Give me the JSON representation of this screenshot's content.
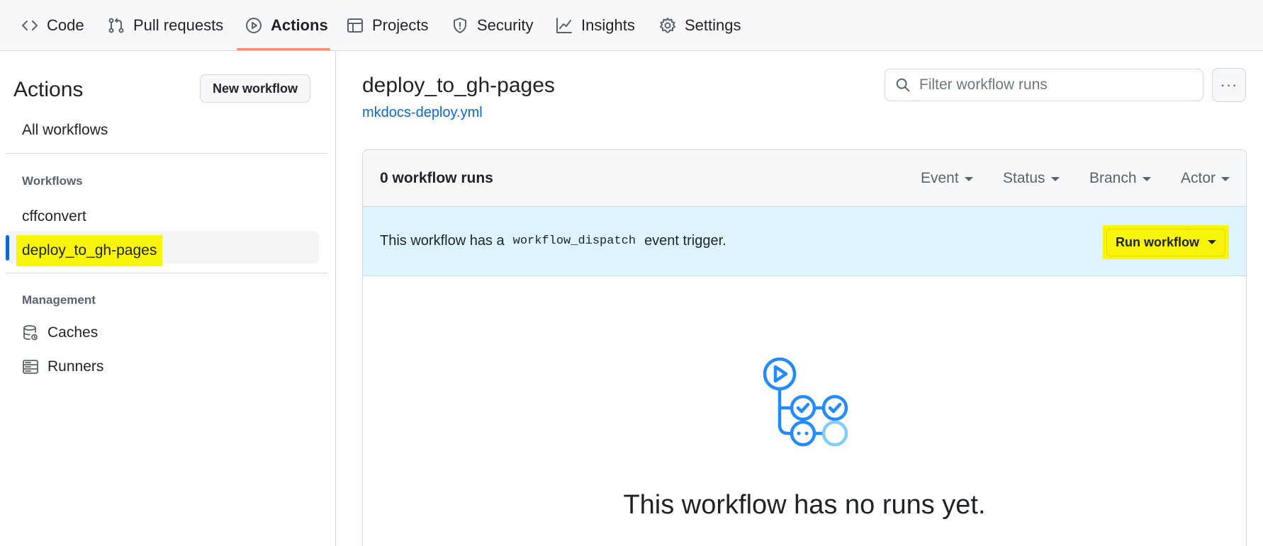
{
  "nav": {
    "tabs": [
      {
        "label": "Code",
        "icon": "code-icon"
      },
      {
        "label": "Pull requests",
        "icon": "pull-request-icon"
      },
      {
        "label": "Actions",
        "icon": "play-icon",
        "active": true
      },
      {
        "label": "Projects",
        "icon": "table-icon"
      },
      {
        "label": "Security",
        "icon": "shield-icon"
      },
      {
        "label": "Insights",
        "icon": "graph-icon"
      },
      {
        "label": "Settings",
        "icon": "gear-icon"
      }
    ]
  },
  "sidebar": {
    "title": "Actions",
    "new_workflow": "New workflow",
    "all_workflows": "All workflows",
    "workflows_heading": "Workflows",
    "workflows": [
      "cffconvert",
      "deploy_to_gh-pages"
    ],
    "management_heading": "Management",
    "management": [
      {
        "label": "Caches",
        "icon": "database-icon"
      },
      {
        "label": "Runners",
        "icon": "server-icon"
      }
    ]
  },
  "main": {
    "title": "deploy_to_gh-pages",
    "file_link": "mkdocs-deploy.yml",
    "search_placeholder": "Filter workflow runs",
    "kebab": "···",
    "runs_count": "0 workflow runs",
    "filters": [
      "Event",
      "Status",
      "Branch",
      "Actor"
    ],
    "banner_prefix": "This workflow has a",
    "banner_code": "workflow_dispatch",
    "banner_suffix": "event trigger.",
    "run_button": "Run workflow",
    "empty_message": "This workflow has no runs yet."
  },
  "colors": {
    "accent": "#0969da",
    "highlight": "#f8f40c",
    "banner_bg": "#ddf4ff",
    "active_underline": "#fd8c73"
  }
}
